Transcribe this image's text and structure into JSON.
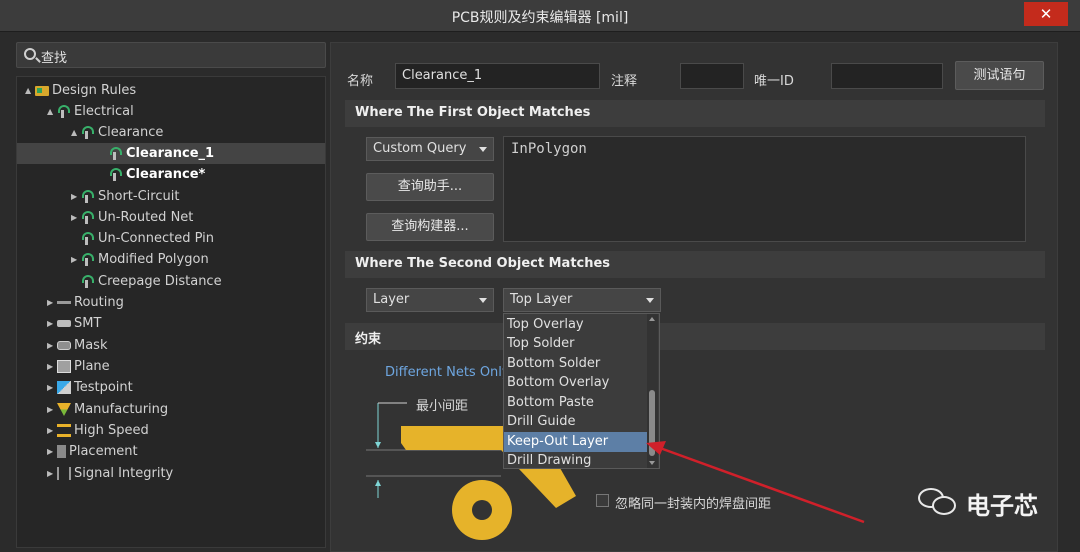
{
  "window": {
    "title": "PCB规则及约束编辑器 [mil]",
    "close_glyph": "✕"
  },
  "search": {
    "label": "查找"
  },
  "tree": {
    "root": "Design Rules",
    "electrical": "Electrical",
    "clearance": "Clearance",
    "clearance_1": "Clearance_1",
    "clearance_star": "Clearance*",
    "short_circuit": "Short-Circuit",
    "un_routed": "Un-Routed Net",
    "un_connected": "Un-Connected Pin",
    "modified_polygon": "Modified Polygon",
    "creepage": "Creepage Distance",
    "routing": "Routing",
    "smt": "SMT",
    "mask": "Mask",
    "plane": "Plane",
    "testpoint": "Testpoint",
    "manufacturing": "Manufacturing",
    "high_speed": "High Speed",
    "placement": "Placement",
    "signal_integrity": "Signal Integrity"
  },
  "rule": {
    "name_label": "名称",
    "name_value": "Clearance_1",
    "comment_label": "注释",
    "comment_value": "",
    "id_label": "唯一ID",
    "id_value": "",
    "test_button": "测试语句"
  },
  "first_match": {
    "header": "Where The First Object Matches",
    "type": "Custom Query",
    "helper_button": "查询助手...",
    "builder_button": "查询构建器...",
    "query_text": "InPolygon"
  },
  "second_match": {
    "header": "Where The Second Object Matches",
    "type": "Layer",
    "layer": "Top Layer"
  },
  "layer_options": [
    "Top Overlay",
    "Top Solder",
    "Bottom Solder",
    "Bottom Overlay",
    "Bottom Paste",
    "Drill Guide",
    "Keep-Out Layer",
    "Drill Drawing"
  ],
  "layer_highlighted": "Keep-Out Layer",
  "constraints": {
    "header": "约束",
    "net_scope": "Different Nets Only",
    "min_clearance_label": "最小间距",
    "ignore_pads_label": "忽略同一封装内的焊盘间距"
  },
  "colors": {
    "copper": "#e6b32a",
    "annotation_arrow": "#d0202a",
    "highlight": "#5d7fa6"
  },
  "watermark": {
    "text": "电子芯"
  }
}
